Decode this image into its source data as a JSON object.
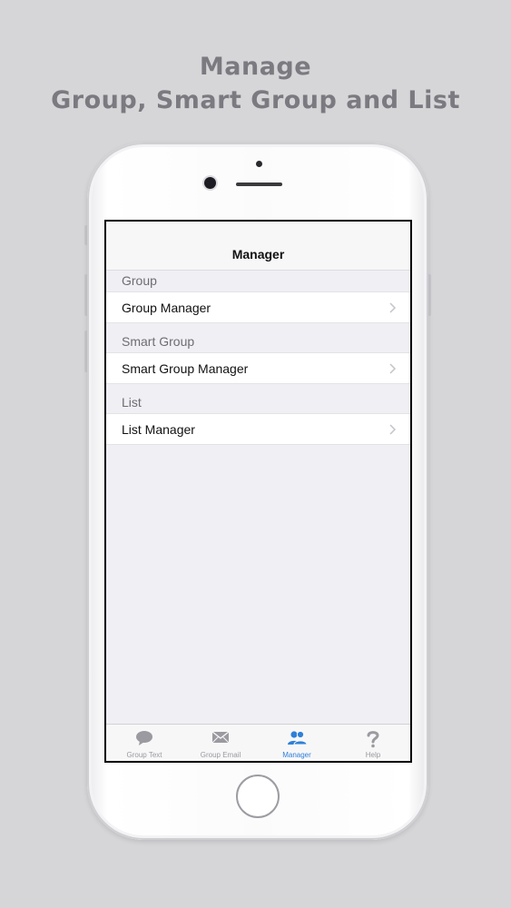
{
  "headline": {
    "line1": "Manage",
    "line2": "Group, Smart Group and List"
  },
  "nav": {
    "title": "Manager"
  },
  "sections": [
    {
      "header": "Group",
      "row_label": "Group Manager"
    },
    {
      "header": "Smart Group",
      "row_label": "Smart Group Manager"
    },
    {
      "header": "List",
      "row_label": "List Manager"
    }
  ],
  "tabs": [
    {
      "label": "Group Text",
      "icon": "speech-bubble-icon",
      "active": false
    },
    {
      "label": "Group Email",
      "icon": "envelope-icon",
      "active": false
    },
    {
      "label": "Manager",
      "icon": "people-icon",
      "active": true
    },
    {
      "label": "Help",
      "icon": "question-mark-icon",
      "active": false
    }
  ],
  "colors": {
    "background": "#d6d6d8",
    "headline": "#7a7a80",
    "accent": "#2f80d8",
    "inactive_tab": "#9a9aa0"
  }
}
